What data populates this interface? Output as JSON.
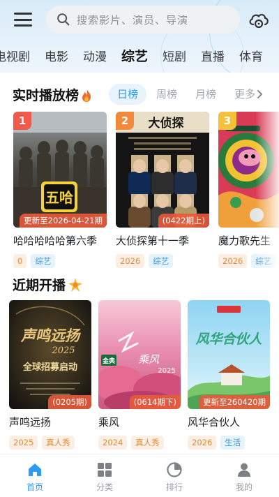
{
  "header": {
    "search_placeholder": "搜索影片、演员、导演",
    "categories": [
      "电视剧",
      "电影",
      "动漫",
      "综艺",
      "短剧",
      "直播",
      "体育"
    ],
    "active_category": "综艺"
  },
  "realtime": {
    "title": "实时播放榜",
    "tabs": [
      "日榜",
      "周榜",
      "月榜",
      "更多"
    ],
    "active_tab": "日榜",
    "items": [
      {
        "rank": "1",
        "rank_color": "#ef5a4b",
        "badge": "更新至2026-04-21期",
        "title": "哈哈哈哈哈第六季",
        "tags": [
          "0",
          "综艺"
        ]
      },
      {
        "rank": "2",
        "rank_color": "#f2893b",
        "badge": "(0422期上)",
        "title": "大侦探第十一季",
        "tags": [
          "2026",
          "综艺"
        ]
      },
      {
        "rank": "3",
        "rank_color": "#f4c23a",
        "badge": "",
        "title": "魔力歌先生",
        "tags": [
          "2026",
          "综艺"
        ]
      }
    ]
  },
  "upcoming": {
    "title": "近期开播",
    "items": [
      {
        "badge": "(0205期)",
        "title": "声鸣远扬",
        "tags": [
          "2025",
          "真人秀"
        ]
      },
      {
        "badge": "(0614期下)",
        "title": "乘风",
        "tags": [
          "2024",
          "真人秀"
        ]
      },
      {
        "badge": "更新至260420期",
        "title": "风华合伙人",
        "tags": [
          "2026",
          "生活"
        ]
      }
    ]
  },
  "posters": {
    "p1_text": "五哈",
    "p2_text": "大侦探",
    "p4_title": "声鸣远扬",
    "p4_year": "2025",
    "p4_sub": "全球招募启动",
    "p5_brand": "金典",
    "p5_title": "乘风",
    "p5_year": "2025",
    "p6_title": "风华合伙人"
  },
  "bottom_nav": [
    {
      "label": "首页",
      "icon": "home-icon",
      "active": true
    },
    {
      "label": "分类",
      "icon": "grid-icon",
      "active": false
    },
    {
      "label": "排行",
      "icon": "ranking-icon",
      "active": false
    },
    {
      "label": "我的",
      "icon": "user-icon",
      "active": false
    }
  ],
  "colors": {
    "accent": "#2d9cf0",
    "badge_bg": "#e65a3c",
    "tag_year": "#e58a3a",
    "tag_genre": "#3d96d8"
  }
}
